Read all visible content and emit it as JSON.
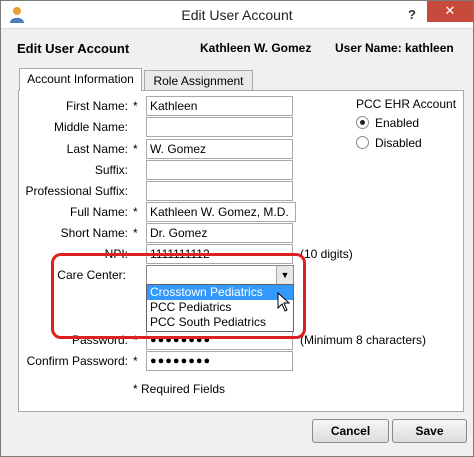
{
  "window": {
    "title": "Edit User Account",
    "help": "?",
    "close": "✕"
  },
  "header": {
    "title": "Edit User Account",
    "user": "Kathleen W. Gomez",
    "username": "User Name: kathleen"
  },
  "tabs": [
    {
      "label": "Account Information"
    },
    {
      "label": "Role Assignment"
    }
  ],
  "form": {
    "first_name": {
      "label": "First Name:",
      "required": "*",
      "value": "Kathleen"
    },
    "middle_name": {
      "label": "Middle Name:",
      "value": ""
    },
    "last_name": {
      "label": "Last Name:",
      "required": "*",
      "value": "W. Gomez"
    },
    "suffix": {
      "label": "Suffix:",
      "value": ""
    },
    "professional_suffix": {
      "label": "Professional Suffix:",
      "value": ""
    },
    "full_name": {
      "label": "Full Name:",
      "required": "*",
      "value": "Kathleen W. Gomez, M.D."
    },
    "short_name": {
      "label": "Short Name:",
      "required": "*",
      "value": "Dr. Gomez"
    },
    "npi": {
      "label": "NPI:",
      "value": "1111111112",
      "hint": "(10 digits)"
    },
    "care_center": {
      "label": "Care Center:",
      "value": "",
      "options": [
        "Crosstown Pediatrics",
        "PCC Pediatrics",
        "PCC South Pediatrics"
      ],
      "highlighted": "Crosstown Pediatrics"
    },
    "password": {
      "label": "Password:",
      "required": "*",
      "value": "●●●●●●●●",
      "hint": "(Minimum 8 characters)"
    },
    "confirm_password": {
      "label": "Confirm Password:",
      "required": "*",
      "value": "●●●●●●●●"
    },
    "required_note": "* Required Fields"
  },
  "ehr": {
    "title": "PCC EHR Account",
    "options": [
      {
        "label": "Enabled",
        "checked": true
      },
      {
        "label": "Disabled",
        "checked": false
      }
    ]
  },
  "buttons": {
    "cancel": "Cancel",
    "save": "Save"
  },
  "colors": {
    "highlight_red": "#e02020",
    "selection_blue": "#3399ff",
    "close_red": "#c74b3c"
  }
}
